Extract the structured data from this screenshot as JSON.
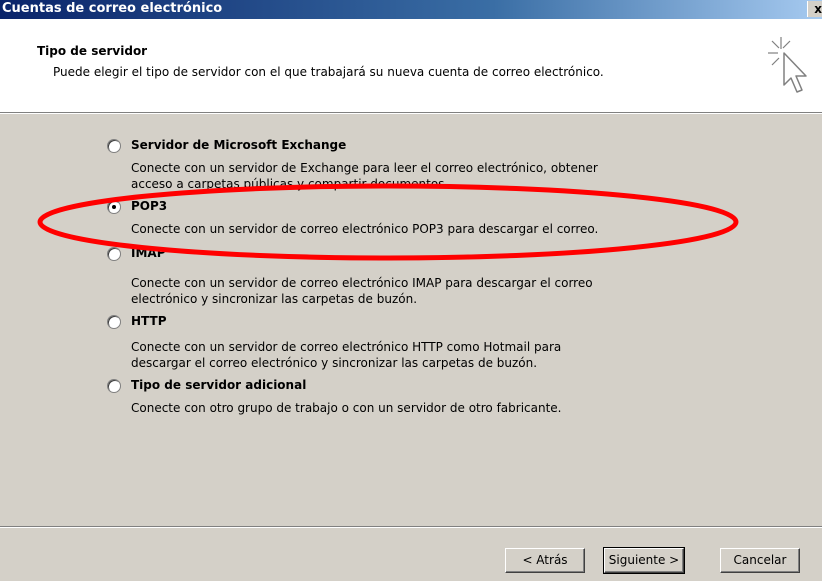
{
  "window": {
    "title": "Cuentas de correo electrónico",
    "close_label": "x"
  },
  "header": {
    "title": "Tipo de servidor",
    "subtitle": "Puede elegir el tipo de servidor con el que trabajará su nueva cuenta de correo electrónico.",
    "icon": "wizard-cursor-sparkle-icon"
  },
  "options": [
    {
      "label": "Servidor de Microsoft Exchange",
      "checked": false,
      "description": [
        "Conecte con un servidor de Exchange para leer el correo electrónico, obtener",
        "acceso a carpetas públicas y compartir documentos."
      ]
    },
    {
      "label": "POP3",
      "checked": true,
      "description": [
        "Conecte con un servidor de correo electrónico POP3 para descargar el correo."
      ]
    },
    {
      "label": "IMAP",
      "checked": false,
      "description": [
        "Conecte con un servidor de correo electrónico IMAP para descargar el correo",
        "electrónico y sincronizar las carpetas de buzón."
      ]
    },
    {
      "label": "HTTP",
      "checked": false,
      "description": [
        "Conecte con un servidor de correo electrónico HTTP como Hotmail para",
        "descargar el correo electrónico y sincronizar las carpetas de buzón."
      ]
    },
    {
      "label": "Tipo de servidor adicional",
      "checked": false,
      "description": [
        "Conecte con otro grupo de trabajo o con un servidor de otro fabricante."
      ]
    }
  ],
  "annotation": {
    "shape": "ellipse",
    "color": "#ff0000",
    "target": "POP3"
  },
  "buttons": {
    "back": "< Atrás",
    "next": "Siguiente >",
    "cancel": "Cancelar"
  },
  "colors": {
    "titlebar_start": "#0a246a",
    "titlebar_end": "#a6caf0",
    "panel": "#d4d0c8",
    "annotation": "#ff0000"
  }
}
